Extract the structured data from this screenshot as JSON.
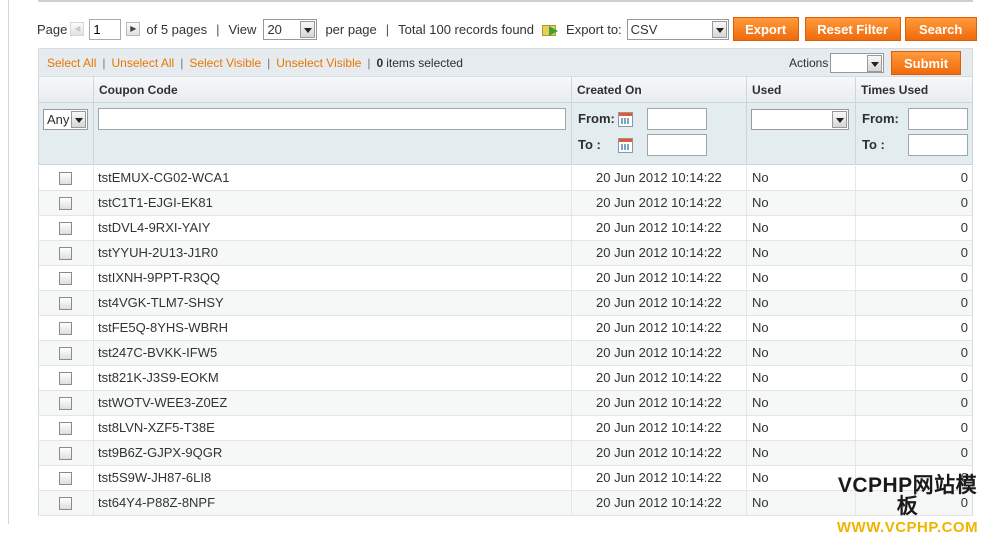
{
  "pager": {
    "page_label": "Page",
    "page_value": "1",
    "of_pages": "of 5 pages",
    "separator": "|",
    "view_label": "View",
    "view_value": "20",
    "per_page_label": "per page",
    "total_records": "Total 100 records found",
    "export_label": "Export to:",
    "export_value": "CSV",
    "export_button": "Export",
    "reset_button": "Reset Filter",
    "search_button": "Search"
  },
  "massaction": {
    "select_all": "Select All",
    "unselect_all": "Unselect All",
    "select_visible": "Select Visible",
    "unselect_visible": "Unselect Visible",
    "separator": "|",
    "selected_count": "0",
    "selected_text": "items selected",
    "actions_label": "Actions",
    "actions_value": "",
    "submit_button": "Submit"
  },
  "columns": {
    "coupon_code": "Coupon Code",
    "created_on": "Created On",
    "used": "Used",
    "times_used": "Times Used"
  },
  "filters": {
    "checkbox_any": "Any",
    "coupon_code_value": "",
    "created_from_label": "From:",
    "created_to_label": "To :",
    "used_value": "",
    "times_from_label": "From:",
    "times_to_label": "To :"
  },
  "rows": [
    {
      "code": "tstEMUX-CG02-WCA1",
      "created": "20 Jun 2012 10:14:22",
      "used": "No",
      "times": "0"
    },
    {
      "code": "tstC1T1-EJGI-EK81",
      "created": "20 Jun 2012 10:14:22",
      "used": "No",
      "times": "0"
    },
    {
      "code": "tstDVL4-9RXI-YAIY",
      "created": "20 Jun 2012 10:14:22",
      "used": "No",
      "times": "0"
    },
    {
      "code": "tstYYUH-2U13-J1R0",
      "created": "20 Jun 2012 10:14:22",
      "used": "No",
      "times": "0"
    },
    {
      "code": "tstIXNH-9PPT-R3QQ",
      "created": "20 Jun 2012 10:14:22",
      "used": "No",
      "times": "0"
    },
    {
      "code": "tst4VGK-TLM7-SHSY",
      "created": "20 Jun 2012 10:14:22",
      "used": "No",
      "times": "0"
    },
    {
      "code": "tstFE5Q-8YHS-WBRH",
      "created": "20 Jun 2012 10:14:22",
      "used": "No",
      "times": "0"
    },
    {
      "code": "tst247C-BVKK-IFW5",
      "created": "20 Jun 2012 10:14:22",
      "used": "No",
      "times": "0"
    },
    {
      "code": "tst821K-J3S9-EOKM",
      "created": "20 Jun 2012 10:14:22",
      "used": "No",
      "times": "0"
    },
    {
      "code": "tstWOTV-WEE3-Z0EZ",
      "created": "20 Jun 2012 10:14:22",
      "used": "No",
      "times": "0"
    },
    {
      "code": "tst8LVN-XZF5-T38E",
      "created": "20 Jun 2012 10:14:22",
      "used": "No",
      "times": "0"
    },
    {
      "code": "tst9B6Z-GJPX-9QGR",
      "created": "20 Jun 2012 10:14:22",
      "used": "No",
      "times": "0"
    },
    {
      "code": "tst5S9W-JH87-6LI8",
      "created": "20 Jun 2012 10:14:22",
      "used": "No",
      "times": "0"
    },
    {
      "code": "tst64Y4-P88Z-8NPF",
      "created": "20 Jun 2012 10:14:22",
      "used": "No",
      "times": "0"
    }
  ],
  "watermark": {
    "line1": "VCPHP网站模板",
    "line2": "WWW.VCPHP.COM"
  },
  "colors": {
    "accent_orange": "#ef6a0c",
    "link_orange": "#ea7601",
    "filter_bg": "#e3ecef"
  }
}
